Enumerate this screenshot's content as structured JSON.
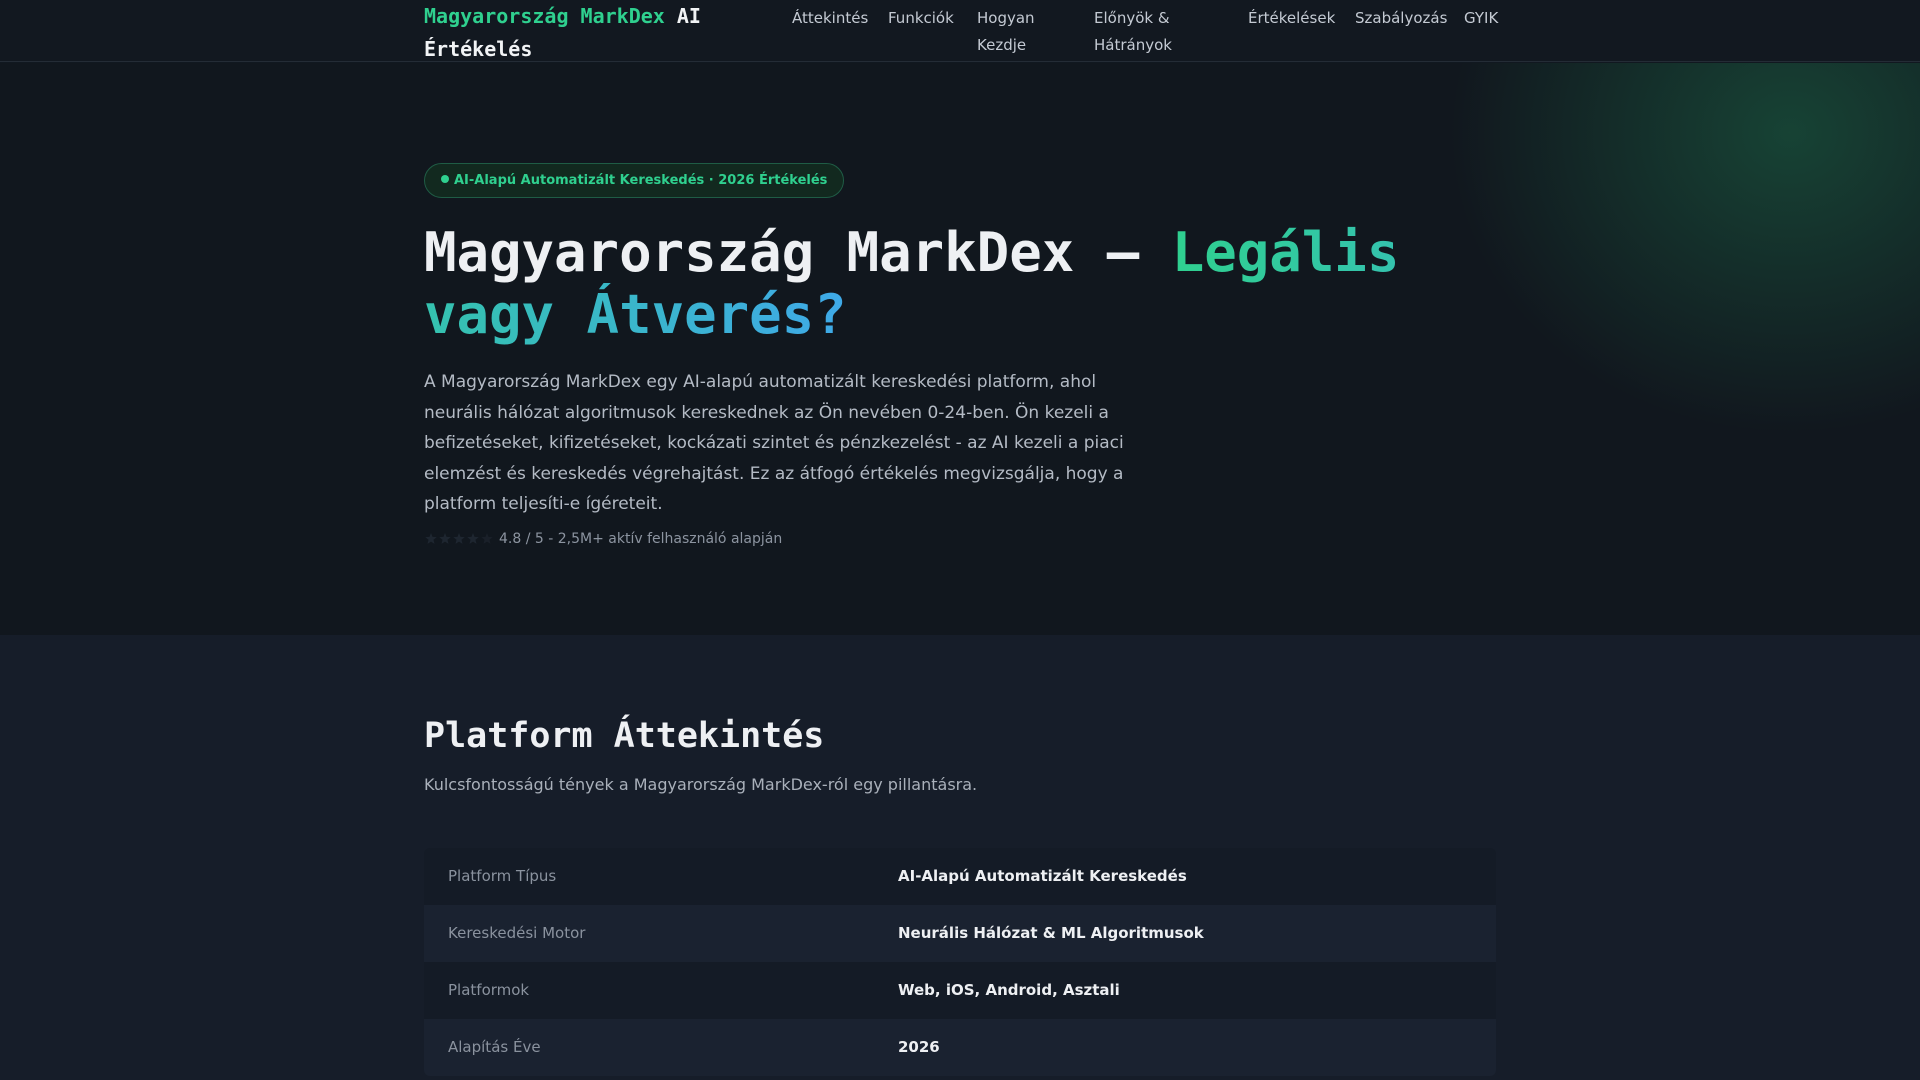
{
  "nav": {
    "brand_accent": "Magyarország MarkDex",
    "brand_rest": " AI Értékelés",
    "links": [
      {
        "label": "Áttekintés"
      },
      {
        "label": "Funkciók"
      },
      {
        "label": "Hogyan Kezdje"
      },
      {
        "label": "Előnyök & Hátrányok"
      },
      {
        "label": "Értékelések"
      },
      {
        "label": "Szabályozás"
      },
      {
        "label": "GYIK"
      }
    ]
  },
  "hero": {
    "badge": "AI-Alapú Automatizált Kereskedés · 2026 Értékelés",
    "title_plain": "Magyarország MarkDex – ",
    "title_highlight": "Legális vagy Átverés?",
    "description": "A Magyarország MarkDex egy AI-alapú automatizált kereskedési platform, ahol neurális hálózat algoritmusok kereskednek az Ön nevében 0-24-ben. Ön kezeli a befizetéseket, kifizetéseket, kockázati szintet és pénzkezelést - az AI kezeli a piaci elemzést és kereskedés végrehajtást. Ez az átfogó értékelés megvizsgálja, hogy a platform teljesíti-e ígéreteit.",
    "rating_text": "4.8 / 5 - 2,5M+ aktív felhasználó alapján",
    "rating_value": 4.8,
    "rating_max": 5
  },
  "overview": {
    "title": "Platform Áttekintés",
    "subtitle": "Kulcsfontosságú tények a Magyarország MarkDex-ról egy pillantásra.",
    "rows": [
      {
        "key": "Platform Típus",
        "value": "AI-Alapú Automatizált Kereskedés"
      },
      {
        "key": "Kereskedési Motor",
        "value": "Neurális Hálózat & ML Algoritmusok"
      },
      {
        "key": "Platformok",
        "value": "Web, iOS, Android, Asztali"
      },
      {
        "key": "Alapítás Éve",
        "value": "2026"
      }
    ]
  },
  "colors": {
    "accent_green": "#2fd08f",
    "accent_blue": "#3fa9e8",
    "background": "#11171e"
  }
}
